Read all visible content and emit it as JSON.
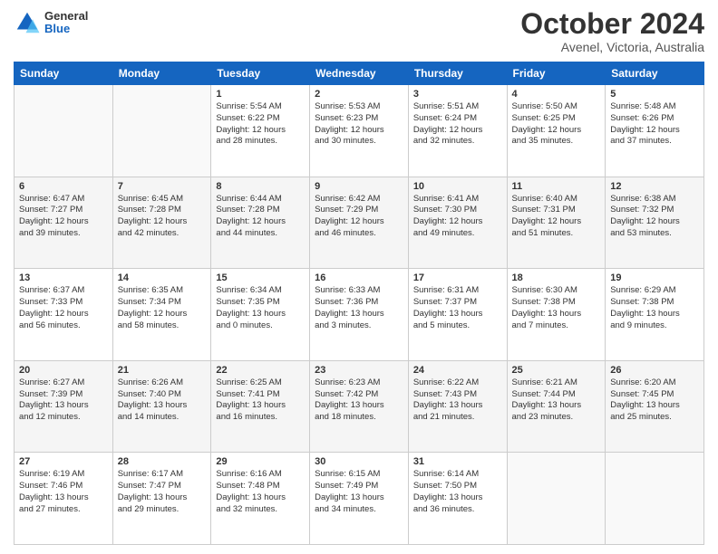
{
  "header": {
    "logo": {
      "general": "General",
      "blue": "Blue"
    },
    "title": "October 2024",
    "location": "Avenel, Victoria, Australia"
  },
  "days_of_week": [
    "Sunday",
    "Monday",
    "Tuesday",
    "Wednesday",
    "Thursday",
    "Friday",
    "Saturday"
  ],
  "weeks": [
    [
      {
        "day": "",
        "content": ""
      },
      {
        "day": "",
        "content": ""
      },
      {
        "day": "1",
        "content": "Sunrise: 5:54 AM\nSunset: 6:22 PM\nDaylight: 12 hours\nand 28 minutes."
      },
      {
        "day": "2",
        "content": "Sunrise: 5:53 AM\nSunset: 6:23 PM\nDaylight: 12 hours\nand 30 minutes."
      },
      {
        "day": "3",
        "content": "Sunrise: 5:51 AM\nSunset: 6:24 PM\nDaylight: 12 hours\nand 32 minutes."
      },
      {
        "day": "4",
        "content": "Sunrise: 5:50 AM\nSunset: 6:25 PM\nDaylight: 12 hours\nand 35 minutes."
      },
      {
        "day": "5",
        "content": "Sunrise: 5:48 AM\nSunset: 6:26 PM\nDaylight: 12 hours\nand 37 minutes."
      }
    ],
    [
      {
        "day": "6",
        "content": "Sunrise: 6:47 AM\nSunset: 7:27 PM\nDaylight: 12 hours\nand 39 minutes."
      },
      {
        "day": "7",
        "content": "Sunrise: 6:45 AM\nSunset: 7:28 PM\nDaylight: 12 hours\nand 42 minutes."
      },
      {
        "day": "8",
        "content": "Sunrise: 6:44 AM\nSunset: 7:28 PM\nDaylight: 12 hours\nand 44 minutes."
      },
      {
        "day": "9",
        "content": "Sunrise: 6:42 AM\nSunset: 7:29 PM\nDaylight: 12 hours\nand 46 minutes."
      },
      {
        "day": "10",
        "content": "Sunrise: 6:41 AM\nSunset: 7:30 PM\nDaylight: 12 hours\nand 49 minutes."
      },
      {
        "day": "11",
        "content": "Sunrise: 6:40 AM\nSunset: 7:31 PM\nDaylight: 12 hours\nand 51 minutes."
      },
      {
        "day": "12",
        "content": "Sunrise: 6:38 AM\nSunset: 7:32 PM\nDaylight: 12 hours\nand 53 minutes."
      }
    ],
    [
      {
        "day": "13",
        "content": "Sunrise: 6:37 AM\nSunset: 7:33 PM\nDaylight: 12 hours\nand 56 minutes."
      },
      {
        "day": "14",
        "content": "Sunrise: 6:35 AM\nSunset: 7:34 PM\nDaylight: 12 hours\nand 58 minutes."
      },
      {
        "day": "15",
        "content": "Sunrise: 6:34 AM\nSunset: 7:35 PM\nDaylight: 13 hours\nand 0 minutes."
      },
      {
        "day": "16",
        "content": "Sunrise: 6:33 AM\nSunset: 7:36 PM\nDaylight: 13 hours\nand 3 minutes."
      },
      {
        "day": "17",
        "content": "Sunrise: 6:31 AM\nSunset: 7:37 PM\nDaylight: 13 hours\nand 5 minutes."
      },
      {
        "day": "18",
        "content": "Sunrise: 6:30 AM\nSunset: 7:38 PM\nDaylight: 13 hours\nand 7 minutes."
      },
      {
        "day": "19",
        "content": "Sunrise: 6:29 AM\nSunset: 7:38 PM\nDaylight: 13 hours\nand 9 minutes."
      }
    ],
    [
      {
        "day": "20",
        "content": "Sunrise: 6:27 AM\nSunset: 7:39 PM\nDaylight: 13 hours\nand 12 minutes."
      },
      {
        "day": "21",
        "content": "Sunrise: 6:26 AM\nSunset: 7:40 PM\nDaylight: 13 hours\nand 14 minutes."
      },
      {
        "day": "22",
        "content": "Sunrise: 6:25 AM\nSunset: 7:41 PM\nDaylight: 13 hours\nand 16 minutes."
      },
      {
        "day": "23",
        "content": "Sunrise: 6:23 AM\nSunset: 7:42 PM\nDaylight: 13 hours\nand 18 minutes."
      },
      {
        "day": "24",
        "content": "Sunrise: 6:22 AM\nSunset: 7:43 PM\nDaylight: 13 hours\nand 21 minutes."
      },
      {
        "day": "25",
        "content": "Sunrise: 6:21 AM\nSunset: 7:44 PM\nDaylight: 13 hours\nand 23 minutes."
      },
      {
        "day": "26",
        "content": "Sunrise: 6:20 AM\nSunset: 7:45 PM\nDaylight: 13 hours\nand 25 minutes."
      }
    ],
    [
      {
        "day": "27",
        "content": "Sunrise: 6:19 AM\nSunset: 7:46 PM\nDaylight: 13 hours\nand 27 minutes."
      },
      {
        "day": "28",
        "content": "Sunrise: 6:17 AM\nSunset: 7:47 PM\nDaylight: 13 hours\nand 29 minutes."
      },
      {
        "day": "29",
        "content": "Sunrise: 6:16 AM\nSunset: 7:48 PM\nDaylight: 13 hours\nand 32 minutes."
      },
      {
        "day": "30",
        "content": "Sunrise: 6:15 AM\nSunset: 7:49 PM\nDaylight: 13 hours\nand 34 minutes."
      },
      {
        "day": "31",
        "content": "Sunrise: 6:14 AM\nSunset: 7:50 PM\nDaylight: 13 hours\nand 36 minutes."
      },
      {
        "day": "",
        "content": ""
      },
      {
        "day": "",
        "content": ""
      }
    ]
  ]
}
